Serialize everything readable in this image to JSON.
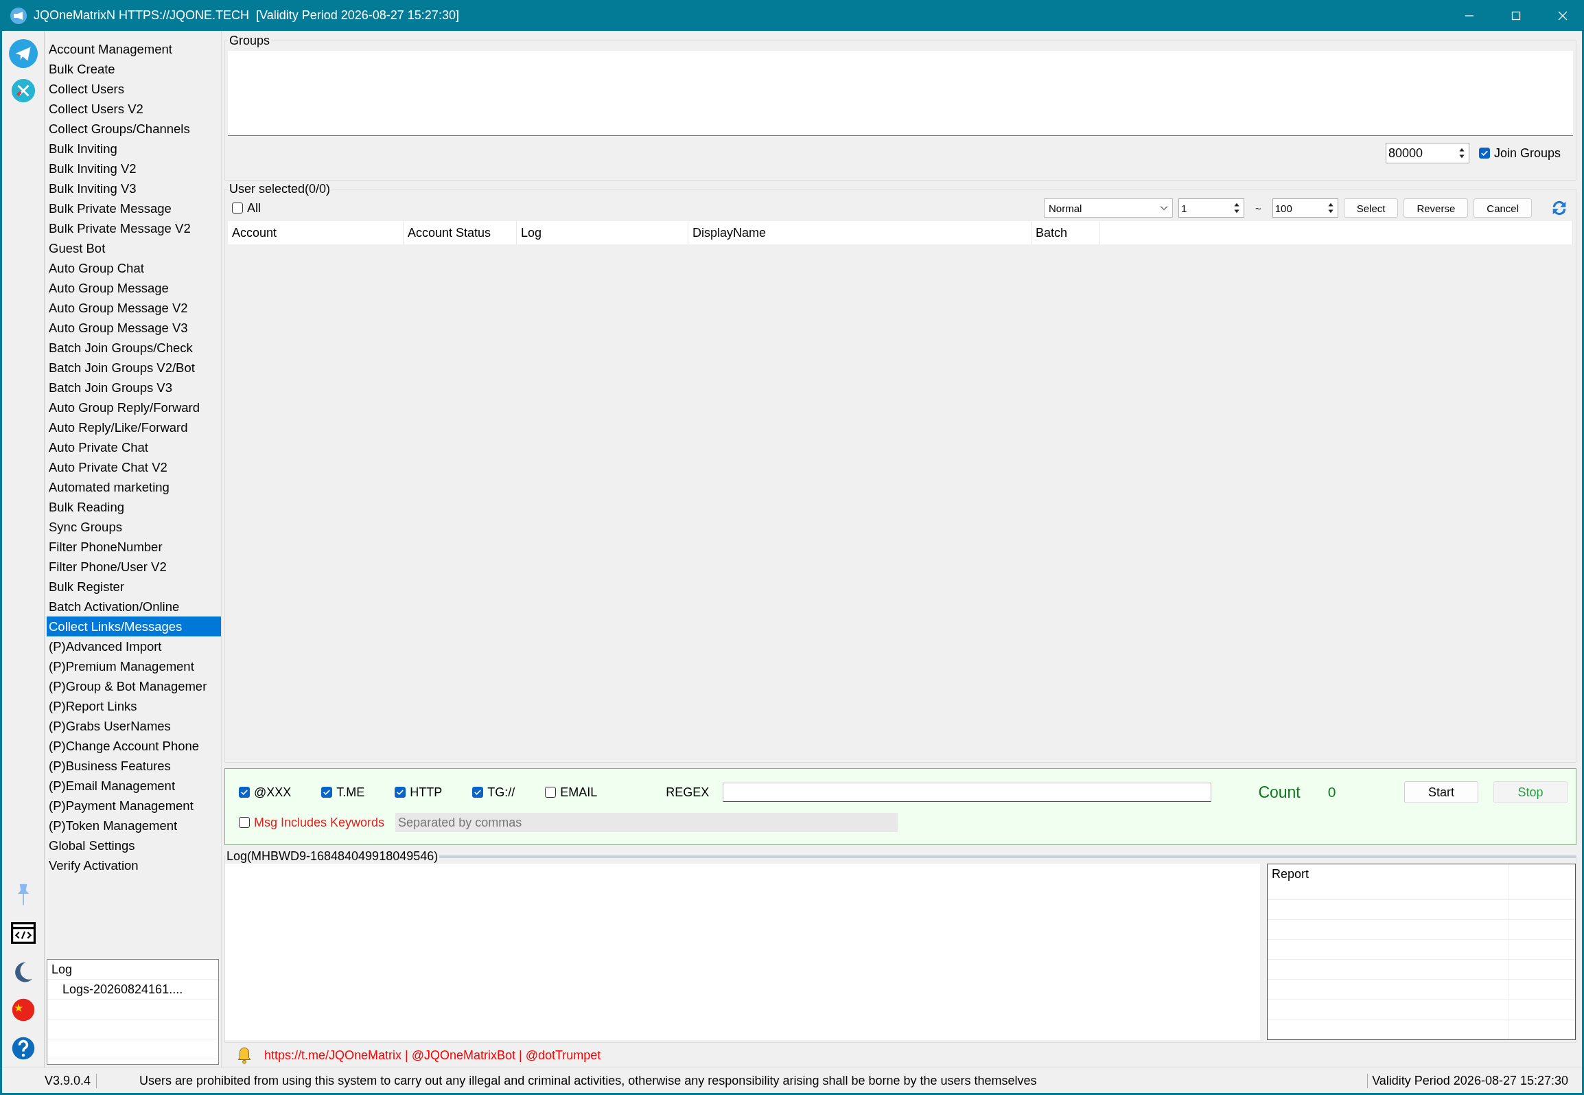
{
  "window": {
    "title": "JQOneMatrixN HTTPS://JQONE.TECH  [Validity Period 2026-08-27 15:27:30]"
  },
  "menu": [
    {
      "label": "Account Management",
      "selected": false
    },
    {
      "label": "Bulk Create",
      "selected": false
    },
    {
      "label": "Collect Users",
      "selected": false
    },
    {
      "label": "Collect Users V2",
      "selected": false
    },
    {
      "label": "Collect Groups/Channels",
      "selected": false
    },
    {
      "label": "Bulk Inviting",
      "selected": false
    },
    {
      "label": "Bulk Inviting V2",
      "selected": false
    },
    {
      "label": "Bulk Inviting V3",
      "selected": false
    },
    {
      "label": "Bulk Private Message",
      "selected": false
    },
    {
      "label": "Bulk Private Message V2",
      "selected": false
    },
    {
      "label": "Guest Bot",
      "selected": false
    },
    {
      "label": "Auto Group Chat",
      "selected": false
    },
    {
      "label": "Auto Group Message",
      "selected": false
    },
    {
      "label": "Auto Group Message V2",
      "selected": false
    },
    {
      "label": "Auto Group Message V3",
      "selected": false
    },
    {
      "label": "Batch Join Groups/Check",
      "selected": false
    },
    {
      "label": "Batch Join Groups V2/Bot",
      "selected": false
    },
    {
      "label": "Batch Join Groups V3",
      "selected": false
    },
    {
      "label": "Auto Group Reply/Forward",
      "selected": false
    },
    {
      "label": "Auto Reply/Like/Forward",
      "selected": false
    },
    {
      "label": "Auto Private Chat",
      "selected": false
    },
    {
      "label": "Auto Private Chat V2",
      "selected": false
    },
    {
      "label": "Automated marketing",
      "selected": false
    },
    {
      "label": "Bulk Reading",
      "selected": false
    },
    {
      "label": "Sync Groups",
      "selected": false
    },
    {
      "label": "Filter PhoneNumber",
      "selected": false
    },
    {
      "label": "Filter Phone/User V2",
      "selected": false
    },
    {
      "label": "Bulk Register",
      "selected": false
    },
    {
      "label": "Batch Activation/Online",
      "selected": false
    },
    {
      "label": "Collect Links/Messages",
      "selected": true
    },
    {
      "label": "(P)Advanced Import",
      "selected": false
    },
    {
      "label": "(P)Premium Management",
      "selected": false
    },
    {
      "label": "(P)Group & Bot Managemer",
      "selected": false
    },
    {
      "label": "(P)Report Links",
      "selected": false
    },
    {
      "label": "(P)Grabs UserNames",
      "selected": false
    },
    {
      "label": "(P)Change Account Phone",
      "selected": false
    },
    {
      "label": "(P)Business Features",
      "selected": false
    },
    {
      "label": "(P)Email Management",
      "selected": false
    },
    {
      "label": "(P)Payment Management",
      "selected": false
    },
    {
      "label": "(P)Token Management",
      "selected": false
    },
    {
      "label": "Global Settings",
      "selected": false
    },
    {
      "label": "Verify Activation",
      "selected": false
    }
  ],
  "log_list": {
    "header": "Log",
    "items": [
      "Logs-20260824161...."
    ]
  },
  "groups": {
    "title": "Groups",
    "limit": "80000",
    "join_groups": {
      "label": "Join Groups",
      "checked": true
    }
  },
  "users": {
    "title": "User selected(0/0)",
    "select_all": {
      "label": "All",
      "checked": false
    },
    "mode": "Normal",
    "range_from": "1",
    "range_separator": "~",
    "range_to": "100",
    "buttons": [
      "Select",
      "Reverse",
      "Cancel"
    ],
    "table": {
      "columns": [
        "Account",
        "Account Status",
        "Log",
        "DisplayName",
        "Batch"
      ]
    }
  },
  "filters": {
    "options": [
      {
        "label": "@XXX",
        "checked": true
      },
      {
        "label": "T.ME",
        "checked": true
      },
      {
        "label": "HTTP",
        "checked": true
      },
      {
        "label": "TG://",
        "checked": true
      },
      {
        "label": "EMAIL",
        "checked": false
      }
    ],
    "regex_label": "REGEX",
    "count_label": "Count",
    "count": "0",
    "buttons": [
      {
        "label": "Start",
        "disabled": false
      },
      {
        "label": "Stop",
        "disabled": true
      }
    ],
    "keywords": {
      "label": "Msg Includes Keywords",
      "checked": false,
      "placeholder": "Separated by commas"
    }
  },
  "log": {
    "title": "Log(MHBWD9-168484049918049546)",
    "report_header": "Report"
  },
  "links": "https://t.me/JQOneMatrix | @JQOneMatrixBot | @dotTrumpet",
  "status_bar": {
    "version": "V3.9.0.4",
    "notice": "Users are prohibited from using this system to carry out any illegal and criminal activities, otherwise any responsibility arising shall be borne by the users themselves",
    "validity": "Validity Period 2026-08-27 15:27:30"
  }
}
